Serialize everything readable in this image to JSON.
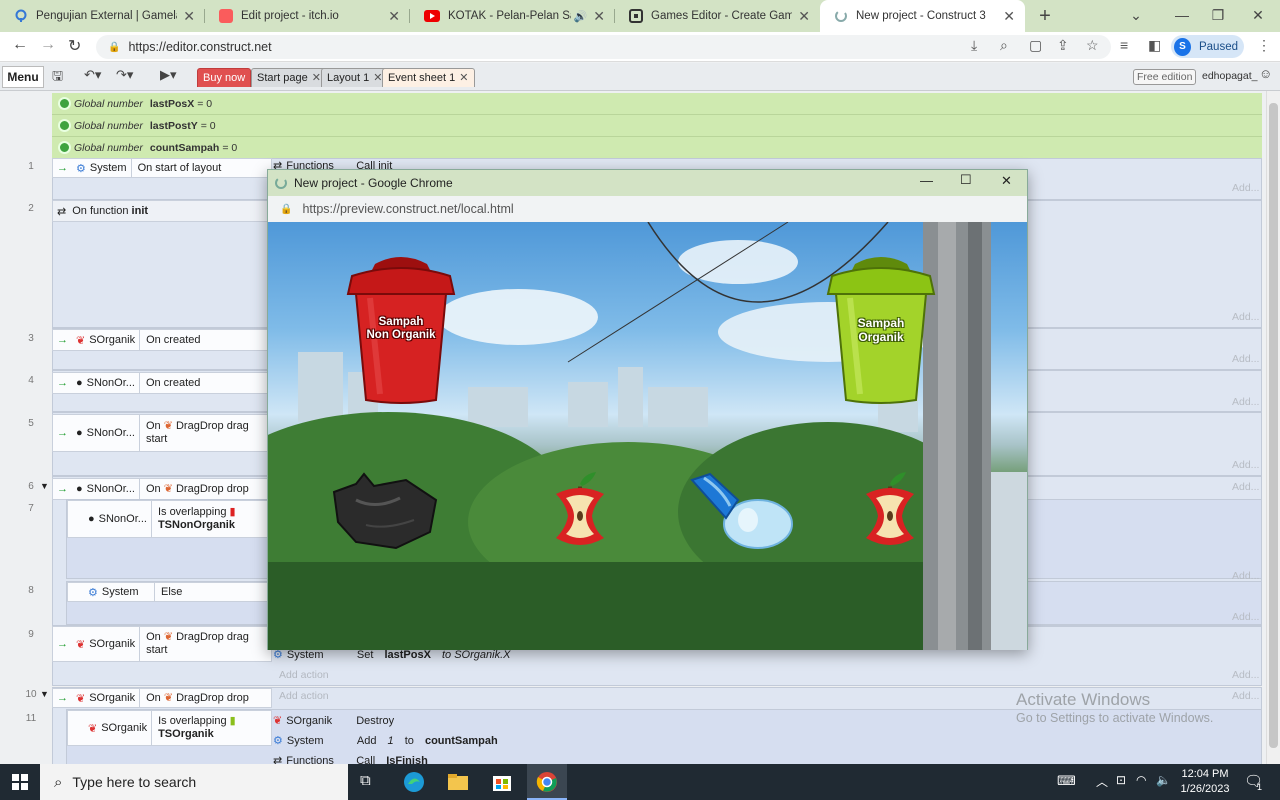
{
  "browser": {
    "tabs": [
      {
        "title": "Pengujian External | Gamelab.ID",
        "favicon": "gamelab-icon",
        "active": false
      },
      {
        "title": "Edit project - itch.io",
        "favicon": "itchio-icon",
        "active": false
      },
      {
        "title": "KOTAK - Pelan-Pelan Saja (O",
        "favicon": "youtube-icon",
        "active": false,
        "audio": true
      },
      {
        "title": "Games Editor - Create Games w",
        "favicon": "construct-icon",
        "active": false
      },
      {
        "title": "New project - Construct 3",
        "favicon": "construct-loading-icon",
        "active": true
      }
    ],
    "url": "https://editor.construct.net",
    "profile": {
      "initial": "S",
      "label": "Paused"
    }
  },
  "construct_toolbar": {
    "menu_label": "Menu",
    "tabs": [
      {
        "label": "Buy now",
        "color": "#e05050"
      },
      {
        "label": "Start page"
      },
      {
        "label": "Layout 1"
      },
      {
        "label": "Event sheet 1"
      }
    ],
    "free_edition": "Free edition",
    "username": "edhopagat_"
  },
  "globals": [
    {
      "prefix": "Global number",
      "name": "lastPosX",
      "value": "= 0"
    },
    {
      "prefix": "Global number",
      "name": "lastPostY",
      "value": "= 0"
    },
    {
      "prefix": "Global number",
      "name": "countSampah",
      "value": "= 0"
    }
  ],
  "events": {
    "e1": {
      "num": "1",
      "object": "System",
      "condition": "On start of layout",
      "action_obj": "Functions",
      "action": "Call init"
    },
    "e2": {
      "num": "2",
      "condition_prefix": "On function",
      "condition": "init"
    },
    "e3": {
      "num": "3",
      "object": "SOrganik",
      "condition": "On created"
    },
    "e4": {
      "num": "4",
      "object": "SNonOr...",
      "condition": "On created"
    },
    "e5": {
      "num": "5",
      "object": "SNonOr...",
      "condition": "On",
      "behavior": "DragDrop drag start"
    },
    "e6": {
      "num": "6",
      "object": "SNonOr...",
      "condition": "On",
      "behavior": "DragDrop drop"
    },
    "e7": {
      "num": "7",
      "object": "SNonOr...",
      "condition": "Is overlapping",
      "target": "TSNonOrganik"
    },
    "e8": {
      "num": "8",
      "object": "System",
      "condition": "Else"
    },
    "e9": {
      "num": "9",
      "object": "SOrganik",
      "condition": "On",
      "behavior": "DragDrop drag start",
      "action_obj": "System",
      "action_prefix": "Set",
      "action_var": "lastPosX",
      "action_suffix": "to SOrganik.X"
    },
    "e10": {
      "num": "10",
      "object": "SOrganik",
      "condition": "On",
      "behavior": "DragDrop drop"
    },
    "e11": {
      "num": "11",
      "object": "SOrganik",
      "condition": "Is overlapping",
      "target": "TSOrganik",
      "actions": [
        {
          "obj": "SOrganik",
          "text": "Destroy"
        },
        {
          "obj": "System",
          "prefix": "Add",
          "num": "1",
          "mid": "to",
          "var": "countSampah"
        },
        {
          "obj": "Functions",
          "prefix": "Call",
          "var": "IsFinish"
        }
      ]
    }
  },
  "add_action": "Add action",
  "add_short": "Add...",
  "popup": {
    "title": "New project - Google Chrome",
    "url": "https://preview.construct.net/local.html",
    "bins": [
      {
        "line1": "Sampah",
        "line2": "Non Organik",
        "color": "#d42020"
      },
      {
        "line1": "Sampah",
        "line2": "Organik",
        "color": "#9bcf1c"
      }
    ]
  },
  "watermark": {
    "line1": "Activate Windows",
    "line2": "Go to Settings to activate Windows."
  },
  "taskbar": {
    "search_placeholder": "Type here to search",
    "time": "12:04 PM",
    "date": "1/26/2023",
    "notif_count": "1"
  }
}
